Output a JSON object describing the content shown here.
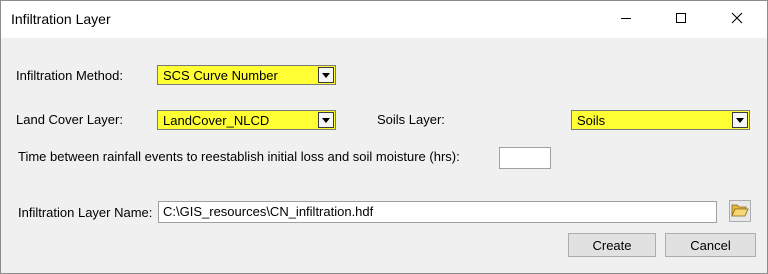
{
  "window": {
    "title": "Infiltration Layer"
  },
  "title_buttons": {
    "minimize_icon": "minimize-icon",
    "maximize_icon": "maximize-icon",
    "close_icon": "close-icon"
  },
  "form": {
    "infiltration_method_label": "Infiltration Method:",
    "infiltration_method_value": "SCS Curve Number",
    "land_cover_label": "Land Cover Layer:",
    "land_cover_value": "LandCover_NLCD",
    "soils_label": "Soils Layer:",
    "soils_value": "Soils",
    "time_label": "Time between rainfall events to reestablish initial loss and soil moisture (hrs):",
    "time_value": "",
    "layer_name_label": "Infiltration Layer Name:",
    "layer_name_value": "C:\\GIS_resources\\CN_infiltration.hdf"
  },
  "buttons": {
    "create": "Create",
    "cancel": "Cancel",
    "browse_icon": "folder-open-icon"
  },
  "colors": {
    "highlight": "#ffff33"
  }
}
